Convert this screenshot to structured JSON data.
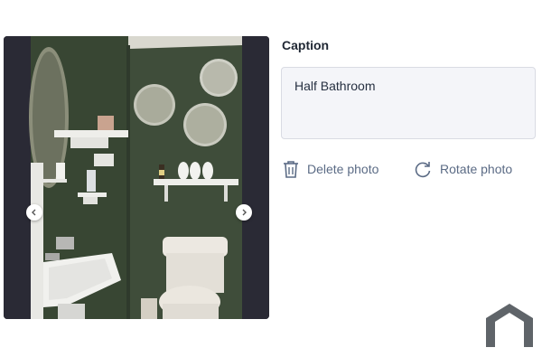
{
  "photo": {
    "alt": "Half Bathroom photo",
    "prev_icon": "chevron-left-icon",
    "next_icon": "chevron-right-icon"
  },
  "caption": {
    "label": "Caption",
    "value": "Half Bathroom"
  },
  "actions": {
    "delete_label": "Delete photo",
    "delete_icon": "trash-icon",
    "rotate_label": "Rotate photo",
    "rotate_icon": "rotate-icon"
  },
  "logo": {
    "icon": "house-outline-icon",
    "color": "#5f6469"
  }
}
